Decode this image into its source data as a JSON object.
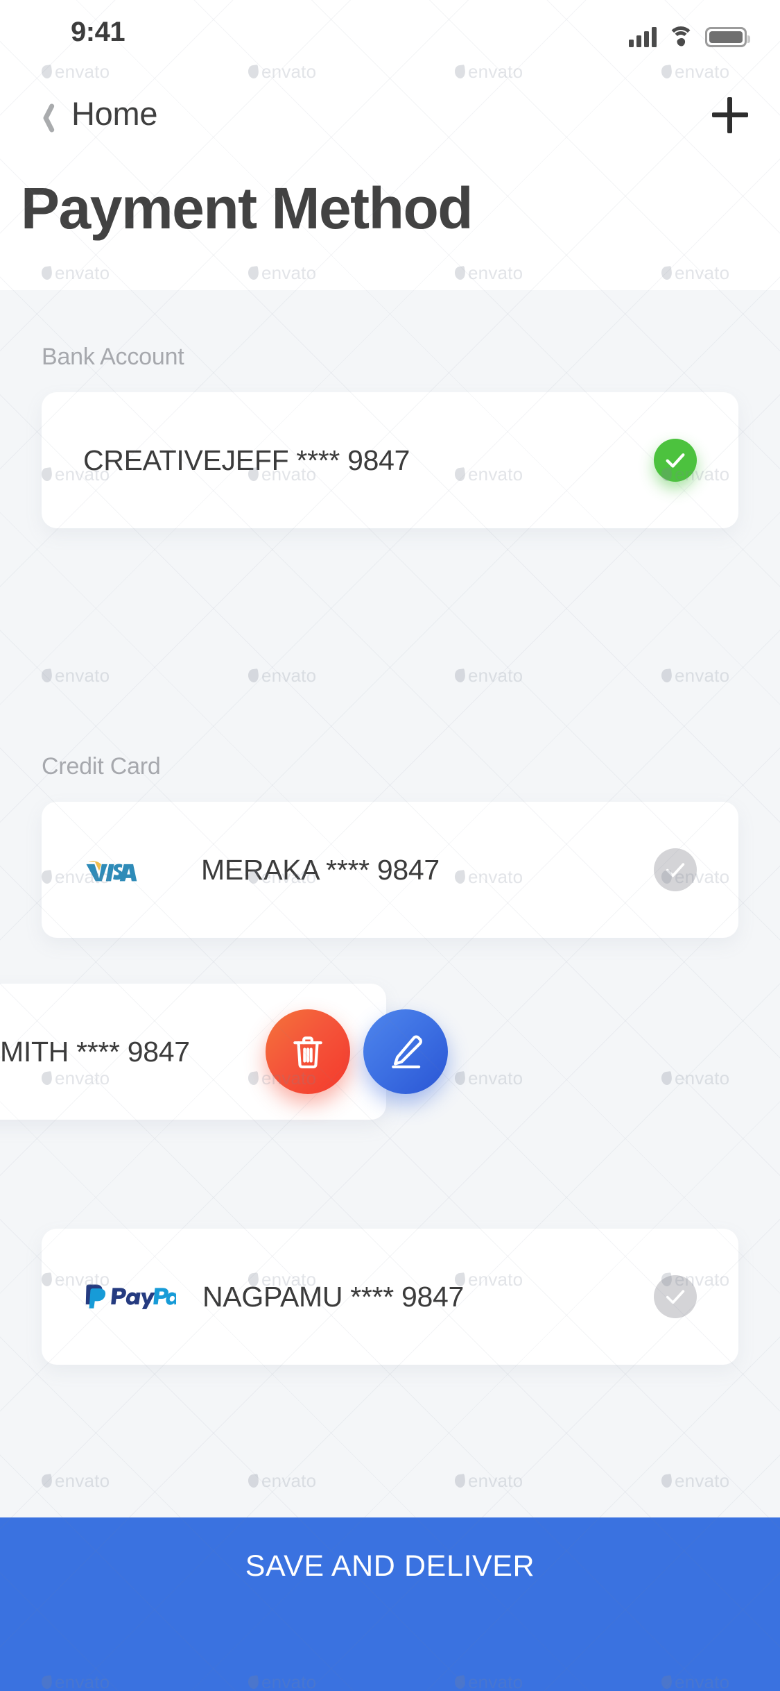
{
  "statusbar": {
    "time": "9:41",
    "signal_icon": "cellular-bars-icon",
    "wifi_icon": "wifi-icon",
    "battery_icon": "battery-full-icon"
  },
  "navbar": {
    "back_icon": "chevron-left-icon",
    "back_label": "Home",
    "add_icon": "plus-icon"
  },
  "page": {
    "title": "Payment Method"
  },
  "sections": [
    {
      "label": "Bank Account",
      "items": [
        {
          "brand": null,
          "text": "CREATIVEJEFF **** 9847",
          "selected": true,
          "check_icon": "check-icon"
        }
      ]
    },
    {
      "label": "Credit Card",
      "items": [
        {
          "brand": "visa",
          "brand_name": "VISA",
          "text": "MERAKA **** 9847",
          "selected": false,
          "check_icon": "check-icon"
        },
        {
          "brand": null,
          "text": "MITH **** 9847",
          "selected": false,
          "check_icon": "check-icon",
          "swiped": true
        },
        {
          "brand": "paypal",
          "brand_name": "PayPal",
          "text": "NAGPAMU **** 9847",
          "selected": false,
          "check_icon": "check-icon"
        }
      ]
    }
  ],
  "swipe_actions": {
    "delete_icon": "trash-icon",
    "edit_icon": "pencil-icon"
  },
  "cta": {
    "label": "SAVE AND DELIVER"
  },
  "watermark": {
    "text": "envato"
  },
  "colors": {
    "page_bg": "#f4f6f8",
    "card_bg": "#ffffff",
    "title": "#424242",
    "section_label": "#a6a8ad",
    "item_text": "#3b3b3b",
    "check_on": "#4cc23e",
    "check_off": "#d4d4d7",
    "delete_start": "#f4743b",
    "delete_end": "#f5392b",
    "edit_start": "#4f86ed",
    "edit_end": "#2a55d4",
    "cta_bg": "#3a72e0",
    "cta_text": "#ffffff",
    "visa_blue": "#2e8bb8",
    "visa_gold": "#efbe51",
    "paypal_dark": "#253b80",
    "paypal_light": "#179bd7"
  }
}
